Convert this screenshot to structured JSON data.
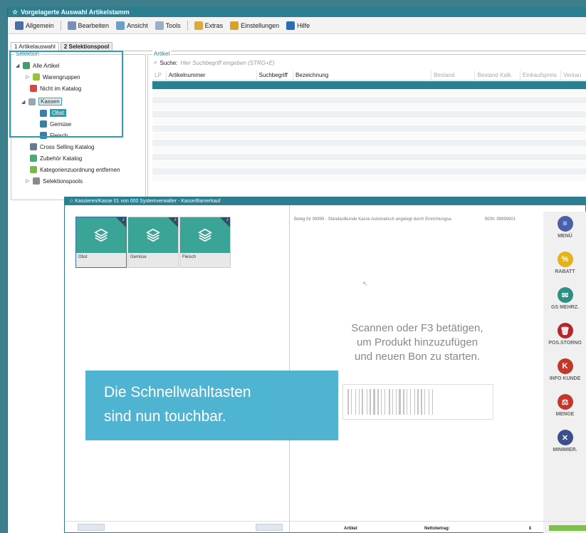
{
  "window": {
    "title": "Vorgelagerte Auswahl Artikelstamm"
  },
  "menu": {
    "items": [
      "Allgemein",
      "Bearbeiten",
      "Ansicht",
      "Tools",
      "Extras",
      "Einstellungen",
      "Hilfe"
    ]
  },
  "tabs": [
    "1 Artikelauswahl",
    "2 Selektionspool"
  ],
  "selection": {
    "legend": "Selektion",
    "tree": [
      "Alle Artikel",
      "Warengruppen",
      "Nicht im Katalog",
      "Kassen",
      "Obst",
      "Gemüse",
      "Fleisch",
      "Cross Selling Katalog",
      "Zubehör Katalog",
      "Kategorienzuordnung entfernen",
      "Selektionspools"
    ]
  },
  "articles": {
    "legend": "Artikel",
    "search_label": "Suche:",
    "search_placeholder": "Hier Suchbegriff eingeben (STRG+E)",
    "columns": [
      "LP",
      "Artikelnummer",
      "Suchbegriff",
      "Bezeichnung",
      "Bestand",
      "Bestand Kalk.",
      "Einkaufspreis",
      "Verkau"
    ]
  },
  "pos": {
    "title": "Kassieren/Kasse 01 von 000 Systemverwalter - Kasse/Barverkauf",
    "tiles": [
      {
        "label": "Obst"
      },
      {
        "label": "Gemüse"
      },
      {
        "label": "Fleisch"
      }
    ],
    "receipt_line": "Beleg für 99999 - Standardkunde Kasse Automatisch angelegt durch Einrichtungsa.",
    "receipt_bez": "BON: 99999901",
    "scan_line1": "Scannen oder F3 betätigen,",
    "scan_line2": "um Produkt hinzuzufügen",
    "scan_line3": "und neuen Bon zu starten.",
    "side_buttons": [
      {
        "label": "MENÜ",
        "icon": "menu-icon",
        "color": "#4a5fa8"
      },
      {
        "label": "RABATT",
        "icon": "discount-icon",
        "color": "#e6b21c"
      },
      {
        "label": "GS MEHRZ.",
        "icon": "voucher-icon",
        "color": "#2e8f82"
      },
      {
        "label": "POS.STORNO",
        "icon": "trash-icon",
        "color": "#b3262d"
      },
      {
        "label": "INFO KUNDE",
        "icon": "customer-info-icon",
        "color": "#c0392b"
      },
      {
        "label": "MENGE",
        "icon": "quantity-icon",
        "color": "#c0392b"
      },
      {
        "label": "MINIMIER.",
        "icon": "minimize-icon",
        "color": "#3d4f8a"
      }
    ],
    "footer": {
      "artikel": "Artikel",
      "netto": "Nettobetrag:",
      "euro": "€"
    }
  },
  "caption": {
    "line1": "Die Schnellwahltasten",
    "line2": "sind nun touchbar."
  }
}
